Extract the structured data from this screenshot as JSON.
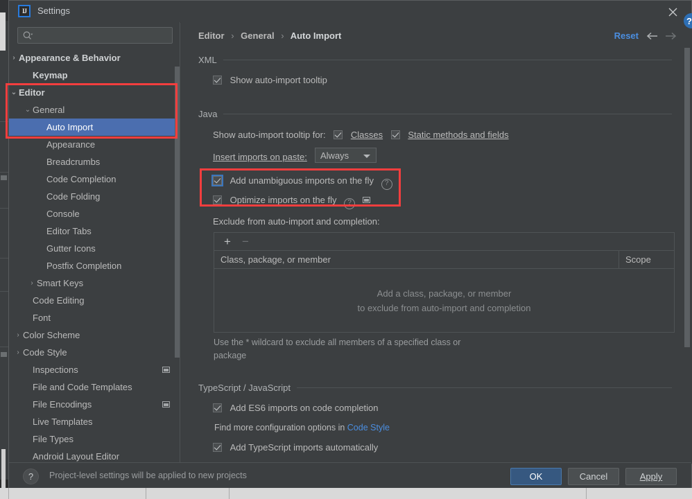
{
  "window": {
    "title": "Settings",
    "logo_text": "IJ",
    "close_icon": "close-icon",
    "help_badge": "?"
  },
  "sidebar": {
    "search": {
      "placeholder": "",
      "value": "",
      "icon": "search-icon"
    },
    "items": [
      {
        "label": "Appearance & Behavior",
        "arrow": "›",
        "indent": 14,
        "bold": true,
        "selected": false,
        "badge": false
      },
      {
        "label": "Keymap",
        "arrow": "",
        "indent": 34,
        "bold": true,
        "selected": false,
        "badge": false
      },
      {
        "label": "Editor",
        "arrow": "⌄",
        "indent": 14,
        "bold": true,
        "selected": false,
        "badge": false
      },
      {
        "label": "General",
        "arrow": "⌄",
        "indent": 34,
        "bold": false,
        "selected": false,
        "badge": false
      },
      {
        "label": "Auto Import",
        "arrow": "",
        "indent": 54,
        "bold": false,
        "selected": true,
        "badge": false
      },
      {
        "label": "Appearance",
        "arrow": "",
        "indent": 54,
        "bold": false,
        "selected": false,
        "badge": false
      },
      {
        "label": "Breadcrumbs",
        "arrow": "",
        "indent": 54,
        "bold": false,
        "selected": false,
        "badge": false
      },
      {
        "label": "Code Completion",
        "arrow": "",
        "indent": 54,
        "bold": false,
        "selected": false,
        "badge": false
      },
      {
        "label": "Code Folding",
        "arrow": "",
        "indent": 54,
        "bold": false,
        "selected": false,
        "badge": false
      },
      {
        "label": "Console",
        "arrow": "",
        "indent": 54,
        "bold": false,
        "selected": false,
        "badge": false
      },
      {
        "label": "Editor Tabs",
        "arrow": "",
        "indent": 54,
        "bold": false,
        "selected": false,
        "badge": false
      },
      {
        "label": "Gutter Icons",
        "arrow": "",
        "indent": 54,
        "bold": false,
        "selected": false,
        "badge": false
      },
      {
        "label": "Postfix Completion",
        "arrow": "",
        "indent": 54,
        "bold": false,
        "selected": false,
        "badge": false
      },
      {
        "label": "Smart Keys",
        "arrow": "›",
        "indent": 40,
        "bold": false,
        "selected": false,
        "badge": false
      },
      {
        "label": "Code Editing",
        "arrow": "",
        "indent": 34,
        "bold": false,
        "selected": false,
        "badge": false
      },
      {
        "label": "Font",
        "arrow": "",
        "indent": 34,
        "bold": false,
        "selected": false,
        "badge": false
      },
      {
        "label": "Color Scheme",
        "arrow": "›",
        "indent": 20,
        "bold": false,
        "selected": false,
        "badge": false
      },
      {
        "label": "Code Style",
        "arrow": "›",
        "indent": 20,
        "bold": false,
        "selected": false,
        "badge": false
      },
      {
        "label": "Inspections",
        "arrow": "",
        "indent": 34,
        "bold": false,
        "selected": false,
        "badge": true
      },
      {
        "label": "File and Code Templates",
        "arrow": "",
        "indent": 34,
        "bold": false,
        "selected": false,
        "badge": false
      },
      {
        "label": "File Encodings",
        "arrow": "",
        "indent": 34,
        "bold": false,
        "selected": false,
        "badge": true
      },
      {
        "label": "Live Templates",
        "arrow": "",
        "indent": 34,
        "bold": false,
        "selected": false,
        "badge": false
      },
      {
        "label": "File Types",
        "arrow": "",
        "indent": 34,
        "bold": false,
        "selected": false,
        "badge": false
      },
      {
        "label": "Android Layout Editor",
        "arrow": "",
        "indent": 34,
        "bold": false,
        "selected": false,
        "badge": false
      }
    ]
  },
  "header": {
    "crumb1": "Editor",
    "crumb2": "General",
    "crumb3": "Auto Import",
    "separator": "›",
    "reset_label": "Reset",
    "back_icon": "arrow-left-icon",
    "forward_icon": "arrow-right-icon"
  },
  "main": {
    "xml": {
      "section_title": "XML",
      "show_tooltip_label": "Show auto-import tooltip",
      "show_tooltip_checked": true
    },
    "java": {
      "section_title": "Java",
      "tooltip_for_label": "Show auto-import tooltip for:",
      "classes_label": "Classes",
      "classes_checked": true,
      "static_label": "Static methods and fields",
      "static_checked": true,
      "insert_label": "Insert imports on paste:",
      "insert_value": "Always",
      "add_unambiguous_label": "Add unambiguous imports on the fly",
      "add_unambiguous_checked": true,
      "optimize_label": "Optimize imports on the fly",
      "optimize_checked": true,
      "exclude_label": "Exclude from auto-import and completion:",
      "table": {
        "add_icon": "+",
        "remove_icon": "−",
        "columns": [
          "Class, package, or member",
          "Scope"
        ],
        "rows": [],
        "empty_line1": "Add a class, package, or member",
        "empty_line2": "to exclude from auto-import and completion"
      },
      "hint": "Use the * wildcard to exclude all members of a specified class or package"
    },
    "ts": {
      "section_title": "TypeScript / JavaScript",
      "es6_label": "Add ES6 imports on code completion",
      "es6_checked": true,
      "find_more_prefix": "Find more configuration options in ",
      "find_more_link": "Code Style",
      "ts_auto_label": "Add TypeScript imports automatically",
      "ts_auto_checked": true
    }
  },
  "footer": {
    "help_icon": "?",
    "note": "Project-level settings will be applied to new projects",
    "ok_label": "OK",
    "cancel_label": "Cancel",
    "apply_label": "Apply"
  },
  "colors": {
    "accent_blue": "#4b6eaf",
    "link_blue": "#4b8ee0",
    "primary_button": "#365880",
    "annotation_red": "#f43e3e",
    "dialog_bg": "#3c3f41"
  }
}
